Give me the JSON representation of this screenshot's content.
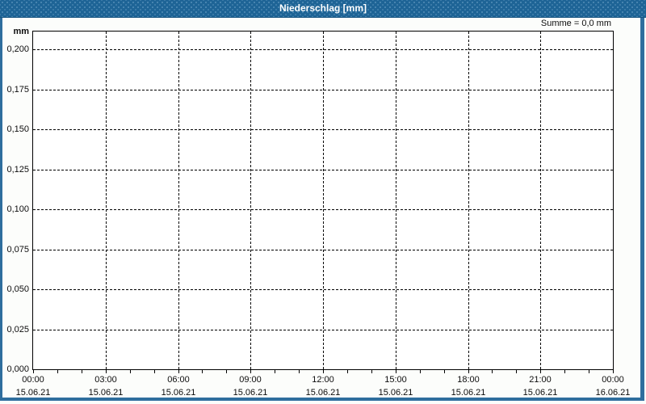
{
  "window": {
    "title": "Niederschlag [mm]"
  },
  "chart_data": {
    "type": "bar",
    "title": "Niederschlag [mm]",
    "unit_label": "mm",
    "sum_label": "Summe = 0,0 mm",
    "sum_mm": 0.0,
    "grid": true,
    "x_axis": {
      "ticks": [
        {
          "time": "00:00",
          "date": "15.06.21"
        },
        {
          "time": "03:00",
          "date": "15.06.21"
        },
        {
          "time": "06:00",
          "date": "15.06.21"
        },
        {
          "time": "09:00",
          "date": "15.06.21"
        },
        {
          "time": "12:00",
          "date": "15.06.21"
        },
        {
          "time": "15:00",
          "date": "15.06.21"
        },
        {
          "time": "18:00",
          "date": "15.06.21"
        },
        {
          "time": "21:00",
          "date": "15.06.21"
        },
        {
          "time": "00:00",
          "date": "16.06.21"
        }
      ],
      "minor_ticks_per_major_interval": 3
    },
    "y_axis": {
      "min": 0,
      "max": 0.21125,
      "ticks": [
        {
          "value": 0.2,
          "label": "0,200"
        },
        {
          "value": 0.175,
          "label": "0,175"
        },
        {
          "value": 0.15,
          "label": "0,150"
        },
        {
          "value": 0.125,
          "label": "0,125"
        },
        {
          "value": 0.1,
          "label": "0,100"
        },
        {
          "value": 0.075,
          "label": "0,075"
        },
        {
          "value": 0.05,
          "label": "0,050"
        },
        {
          "value": 0.025,
          "label": "0,025"
        },
        {
          "value": 0.0,
          "label": "0,000"
        }
      ]
    },
    "series": [
      {
        "name": "Niederschlag",
        "values": [
          0,
          0,
          0,
          0,
          0,
          0,
          0,
          0,
          0
        ]
      }
    ]
  }
}
